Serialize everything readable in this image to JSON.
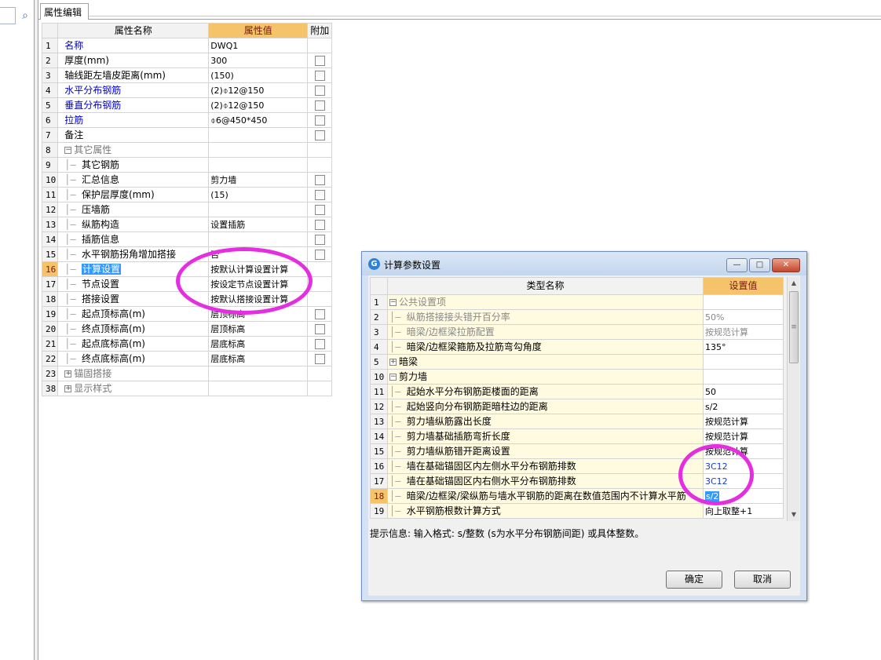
{
  "tab": {
    "label": "属性编辑"
  },
  "prop_grid": {
    "headers": [
      "属性名称",
      "属性值",
      "附加"
    ],
    "rows": [
      {
        "n": "1",
        "name": "名称",
        "value": "DWQ1",
        "style": "blue",
        "chk": false
      },
      {
        "n": "2",
        "name": "厚度(mm)",
        "value": "300",
        "style": "",
        "chk": true
      },
      {
        "n": "3",
        "name": "轴线距左墙皮距离(mm)",
        "value": "(150)",
        "style": "",
        "chk": true
      },
      {
        "n": "4",
        "name": "水平分布钢筋",
        "value": "(2)⌽12@150",
        "style": "blue",
        "chk": true
      },
      {
        "n": "5",
        "name": "垂直分布钢筋",
        "value": "(2)⌽12@150",
        "style": "blue",
        "chk": true
      },
      {
        "n": "6",
        "name": "拉筋",
        "value": "⌽6@450*450",
        "style": "blue",
        "chk": true
      },
      {
        "n": "7",
        "name": "备注",
        "value": "",
        "style": "",
        "chk": true
      },
      {
        "n": "8",
        "name": "其它属性",
        "value": "",
        "style": "group-open",
        "chk": false
      },
      {
        "n": "9",
        "name": "其它钢筋",
        "value": "",
        "style": "child",
        "chk": false
      },
      {
        "n": "10",
        "name": "汇总信息",
        "value": "剪力墙",
        "style": "child",
        "chk": true
      },
      {
        "n": "11",
        "name": "保护层厚度(mm)",
        "value": "(15)",
        "style": "child",
        "chk": true
      },
      {
        "n": "12",
        "name": "压墙筋",
        "value": "",
        "style": "child",
        "chk": true
      },
      {
        "n": "13",
        "name": "纵筋构造",
        "value": "设置插筋",
        "style": "child",
        "chk": true
      },
      {
        "n": "14",
        "name": "插筋信息",
        "value": "",
        "style": "child",
        "chk": true
      },
      {
        "n": "15",
        "name": "水平钢筋拐角增加搭接",
        "value": "否",
        "style": "child",
        "chk": true
      },
      {
        "n": "16",
        "name": "计算设置",
        "value": "按默认计算设置计算",
        "style": "child-selected",
        "chk": false
      },
      {
        "n": "17",
        "name": "节点设置",
        "value": "按设定节点设置计算",
        "style": "child",
        "chk": false
      },
      {
        "n": "18",
        "name": "搭接设置",
        "value": "按默认搭接设置计算",
        "style": "child",
        "chk": false
      },
      {
        "n": "19",
        "name": "起点顶标高(m)",
        "value": "层顶标高",
        "style": "child",
        "chk": true
      },
      {
        "n": "20",
        "name": "终点顶标高(m)",
        "value": "层顶标高",
        "style": "child",
        "chk": true
      },
      {
        "n": "21",
        "name": "起点底标高(m)",
        "value": "层底标高",
        "style": "child",
        "chk": true
      },
      {
        "n": "22",
        "name": "终点底标高(m)",
        "value": "层底标高",
        "style": "child-last",
        "chk": true
      },
      {
        "n": "23",
        "name": "锚固搭接",
        "value": "",
        "style": "group-closed",
        "chk": false
      },
      {
        "n": "38",
        "name": "显示样式",
        "value": "",
        "style": "group-closed",
        "chk": false
      }
    ]
  },
  "dialog": {
    "title": "计算参数设置",
    "headers": [
      "类型名称",
      "设置值"
    ],
    "rows": [
      {
        "n": "1",
        "name": "公共设置项",
        "value": "",
        "style": "group-open grey"
      },
      {
        "n": "2",
        "name": "纵筋搭接接头错开百分率",
        "value": "50%",
        "style": "child grey"
      },
      {
        "n": "3",
        "name": "暗梁/边框梁拉筋配置",
        "value": "按规范计算",
        "style": "child grey"
      },
      {
        "n": "4",
        "name": "暗梁/边框梁箍筋及拉筋弯勾角度",
        "value": "135°",
        "style": "child-last"
      },
      {
        "n": "5",
        "name": "暗梁",
        "value": "",
        "style": "group-closed"
      },
      {
        "n": "10",
        "name": "剪力墙",
        "value": "",
        "style": "group-open"
      },
      {
        "n": "11",
        "name": "起始水平分布钢筋距楼面的距离",
        "value": "50",
        "style": "child"
      },
      {
        "n": "12",
        "name": "起始竖向分布钢筋距暗柱边的距离",
        "value": "s/2",
        "style": "child"
      },
      {
        "n": "13",
        "name": "剪力墙纵筋露出长度",
        "value": "按规范计算",
        "style": "child"
      },
      {
        "n": "14",
        "name": "剪力墙基础插筋弯折长度",
        "value": "按规范计算",
        "style": "child"
      },
      {
        "n": "15",
        "name": "剪力墙纵筋错开距离设置",
        "value": "按规范计算",
        "style": "child"
      },
      {
        "n": "16",
        "name": "墙在基础锚固区内左侧水平分布钢筋排数",
        "value": "3C12",
        "style": "child blue"
      },
      {
        "n": "17",
        "name": "墙在基础锚固区内右侧水平分布钢筋排数",
        "value": "3C12",
        "style": "child blue"
      },
      {
        "n": "18",
        "name": "暗梁/边框梁/梁纵筋与墙水平钢筋的距离在数值范围内不计算水平筋",
        "value": "s/2",
        "style": "child selected"
      },
      {
        "n": "19",
        "name": "水平钢筋根数计算方式",
        "value": "向上取整+1",
        "style": "child"
      }
    ],
    "hint": "提示信息: 输入格式: s/整数 (s为水平分布钢筋间距) 或具体整数。",
    "ok_label": "确定",
    "cancel_label": "取消"
  },
  "colors": {
    "accent_header": "#f5c46a",
    "selection": "#3399ff",
    "annotation": "#e52ee0",
    "link_blue": "#0000c8"
  }
}
